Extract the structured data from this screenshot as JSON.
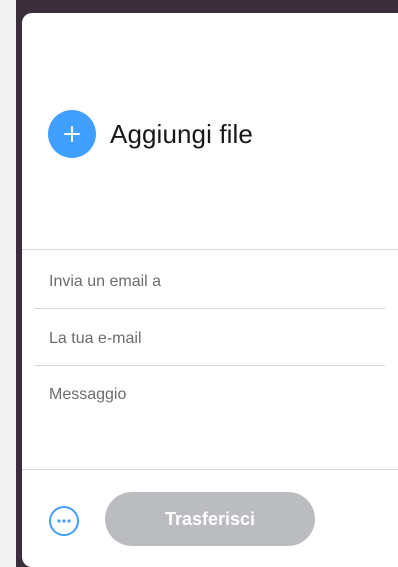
{
  "upload": {
    "add_files_label": "Aggiungi file",
    "icon": "plus-icon"
  },
  "form": {
    "recipient_placeholder": "Invia un email a",
    "recipient_value": "",
    "sender_placeholder": "La tua e-mail",
    "sender_value": "",
    "message_placeholder": "Messaggio",
    "message_value": ""
  },
  "footer": {
    "more_icon": "more-options-icon",
    "transfer_label": "Trasferisci"
  },
  "colors": {
    "accent": "#409fff",
    "button_disabled": "#babcbf",
    "divider": "#d4d7d9",
    "background": "#3a2e3a"
  }
}
